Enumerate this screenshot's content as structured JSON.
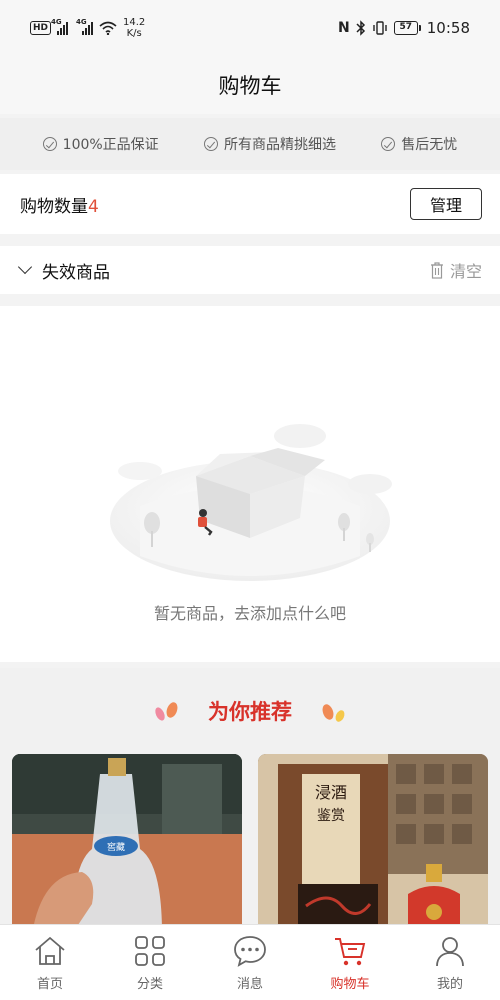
{
  "status_bar": {
    "hd_badge": "HD",
    "network_1": "4G",
    "network_2": "4G",
    "speed_value": "14.2",
    "speed_unit": "K/s",
    "nfc_label": "N",
    "battery": "57",
    "time": "10:58"
  },
  "header": {
    "title": "购物车"
  },
  "guarantees": [
    "100%正品保证",
    "所有商品精挑细选",
    "售后无忧"
  ],
  "cart": {
    "count_label": "购物数量",
    "count": "4",
    "manage_label": "管理"
  },
  "invalid": {
    "label": "失效商品",
    "clear_label": "清空"
  },
  "empty": {
    "message": "暂无商品，去添加点什么吧"
  },
  "recommend": {
    "title": "为你推荐",
    "bottle_label": "窖藏",
    "box_label_top": "浸酒",
    "box_label_bottom": "鉴赏"
  },
  "tabs": [
    {
      "label": "首页",
      "icon": "home-icon"
    },
    {
      "label": "分类",
      "icon": "grid-icon"
    },
    {
      "label": "消息",
      "icon": "chat-icon"
    },
    {
      "label": "购物车",
      "icon": "cart-icon",
      "active": true
    },
    {
      "label": "我的",
      "icon": "user-icon"
    }
  ],
  "colors": {
    "accent": "#d8322a",
    "count": "#e0503a",
    "muted": "#777777"
  }
}
